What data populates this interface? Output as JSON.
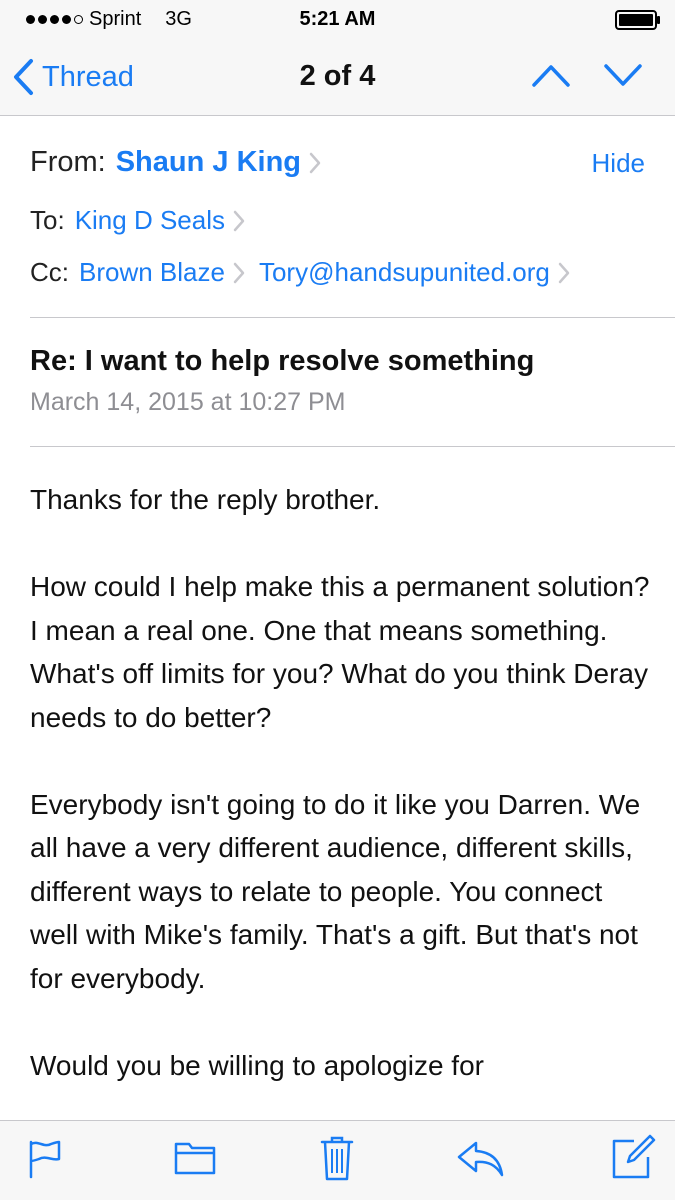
{
  "status_bar": {
    "carrier": "Sprint",
    "network": "3G",
    "time": "5:21 AM",
    "signal_bars_filled": 4,
    "signal_bars_total": 5
  },
  "nav": {
    "back_label": "Thread",
    "title": "2 of 4",
    "accent_color": "#1a7cf3"
  },
  "header": {
    "from_label": "From:",
    "from_name": "Shaun J King",
    "hide_label": "Hide",
    "to_label": "To:",
    "to_name": "King D Seals",
    "cc_label": "Cc:",
    "cc_1": "Brown Blaze",
    "cc_2": "Tory@handsupunited.org"
  },
  "message": {
    "subject": "Re: I want to help resolve something",
    "date": "March 14, 2015 at 10:27 PM",
    "paragraphs": [
      "Thanks for the reply brother.",
      "How could I help make this a permanent solution? I mean a real one. One that means something. What's off limits for you? What do you think Deray needs to do better?",
      "Everybody isn't going to do it like you Darren. We all have a very different audience, different skills, different ways to relate to people. You connect well with Mike's family. That's a gift. But that's not for everybody.",
      "Would you be willing to apologize for"
    ]
  },
  "toolbar": {
    "icons": [
      "flag-icon",
      "folder-icon",
      "trash-icon",
      "reply-icon",
      "compose-icon"
    ]
  }
}
